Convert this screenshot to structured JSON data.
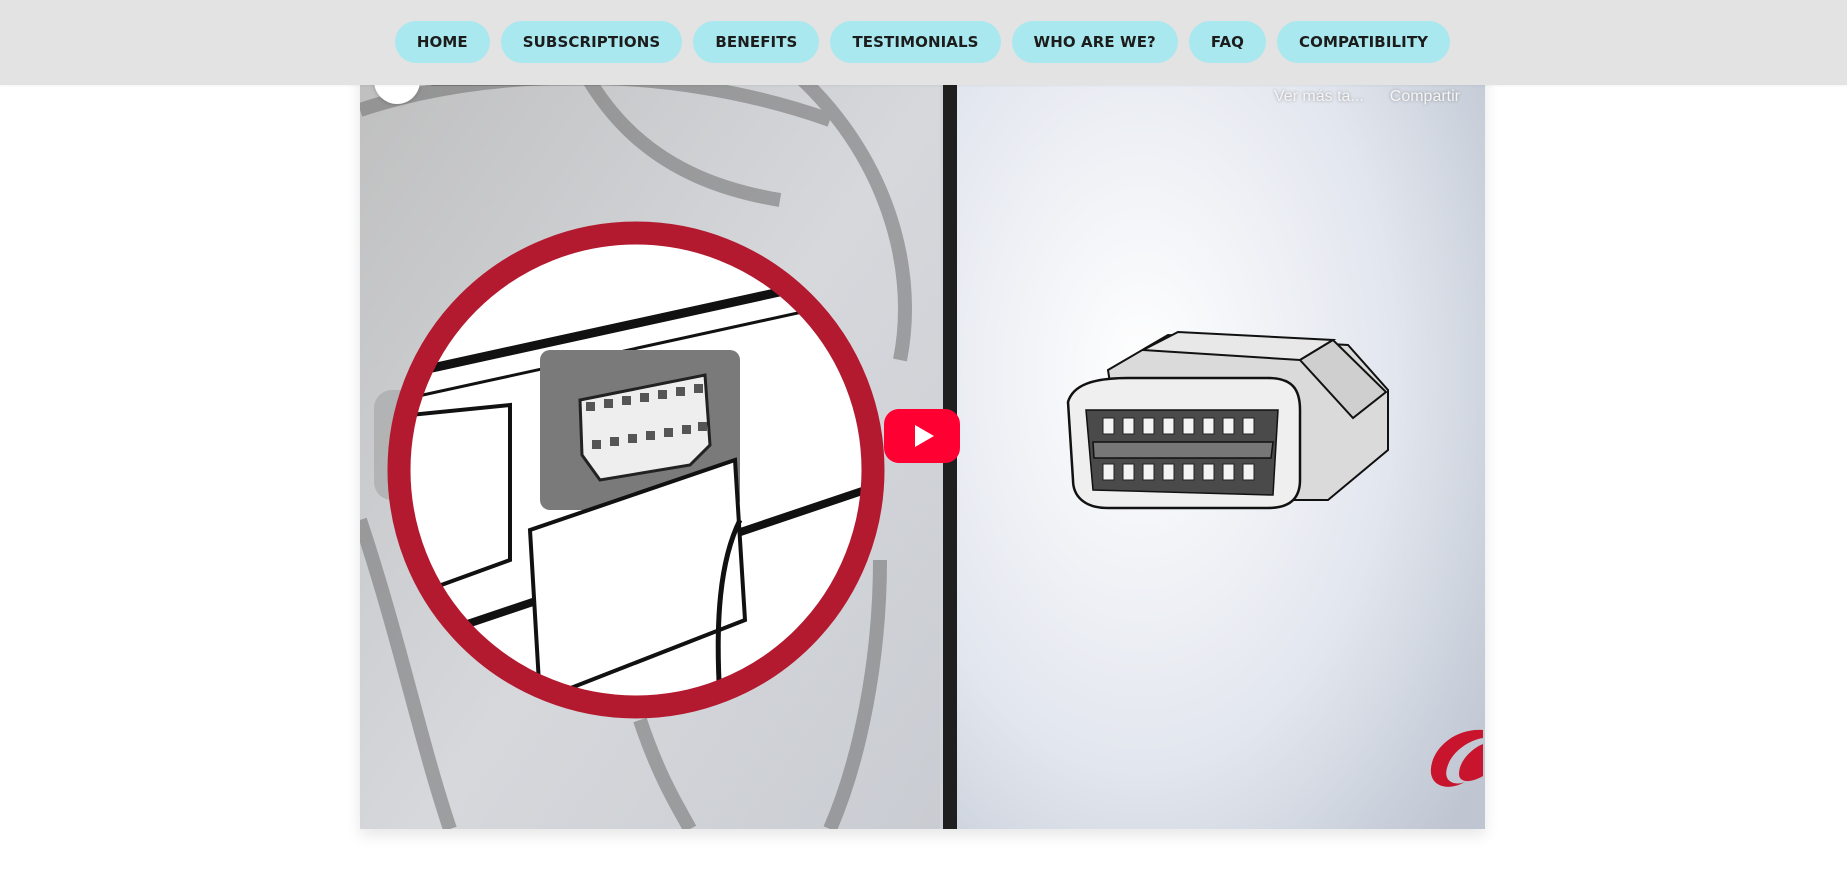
{
  "nav": {
    "items": [
      {
        "label": "HOME"
      },
      {
        "label": "SUBSCRIPTIONS"
      },
      {
        "label": "BENEFITS"
      },
      {
        "label": "TESTIMONIALS"
      },
      {
        "label": "WHO ARE WE?"
      },
      {
        "label": "FAQ"
      },
      {
        "label": "COMPATIBILITY"
      }
    ]
  },
  "video": {
    "watch_later_label": "Ver más ta...",
    "share_label": "Compartir",
    "play_icon": "play-icon",
    "accent_color": "#ff0033",
    "ring_color": "#b3192f"
  },
  "colors": {
    "topbar": "#e3e3e3",
    "nav_pill": "#a9e8ee"
  }
}
